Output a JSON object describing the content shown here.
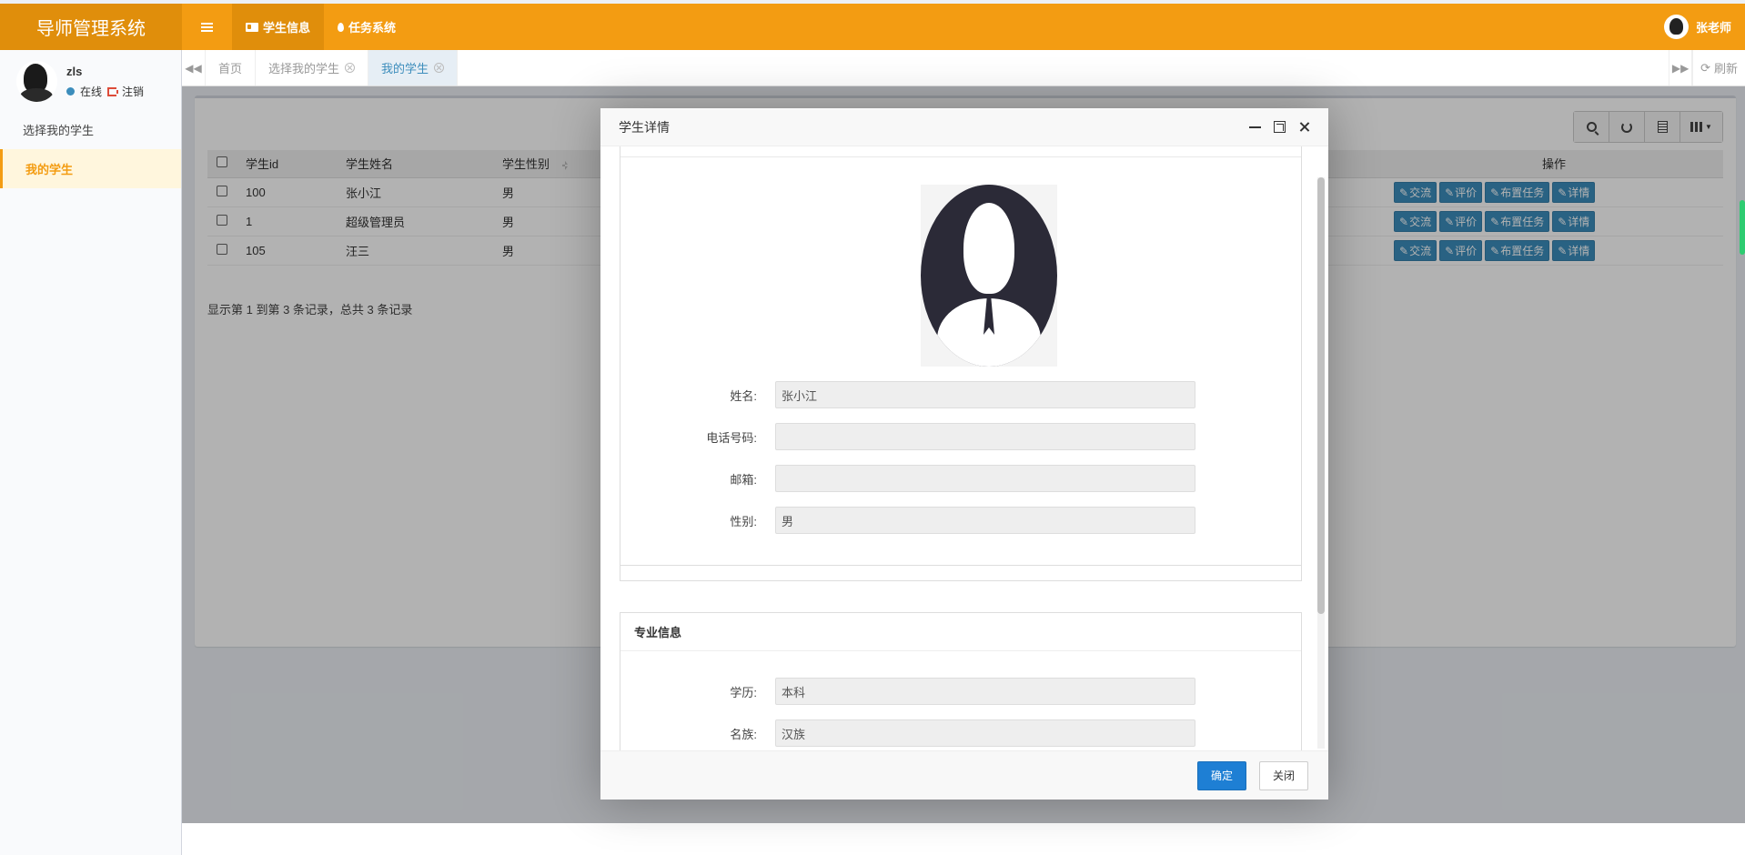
{
  "app": {
    "title": "导师管理系统"
  },
  "header": {
    "nav": [
      {
        "label": "学生信息",
        "icon": "id-card-icon"
      },
      {
        "label": "任务系统",
        "icon": "tint-icon"
      }
    ],
    "user": "张老师"
  },
  "sidebar": {
    "username": "zls",
    "online": "在线",
    "logout": "注销",
    "items": [
      {
        "label": "选择我的学生"
      },
      {
        "label": "我的学生"
      }
    ]
  },
  "tabs": {
    "items": [
      {
        "label": "首页"
      },
      {
        "label": "选择我的学生"
      },
      {
        "label": "我的学生"
      }
    ],
    "refresh": "刷新"
  },
  "table": {
    "headers": [
      "学生id",
      "学生姓名",
      "学生性别",
      "操作"
    ],
    "rows": [
      {
        "id": "100",
        "name": "张小江",
        "gender": "男"
      },
      {
        "id": "1",
        "name": "超级管理员",
        "gender": "男"
      },
      {
        "id": "105",
        "name": "汪三",
        "gender": "男"
      }
    ],
    "ops": [
      "交流",
      "评价",
      "布置任务",
      "详情"
    ],
    "pager": "显示第 1 到第 3 条记录，总共 3 条记录"
  },
  "modal": {
    "title": "学生详情",
    "fields": [
      {
        "label": "姓名:",
        "value": "张小江"
      },
      {
        "label": "电话号码:",
        "value": ""
      },
      {
        "label": "邮箱:",
        "value": ""
      },
      {
        "label": "性别:",
        "value": "男"
      }
    ],
    "section2": {
      "title": "专业信息",
      "fields": [
        {
          "label": "学历:",
          "value": "本科"
        },
        {
          "label": "名族:",
          "value": "汉族"
        }
      ]
    },
    "confirm": "确定",
    "close": "关闭"
  }
}
